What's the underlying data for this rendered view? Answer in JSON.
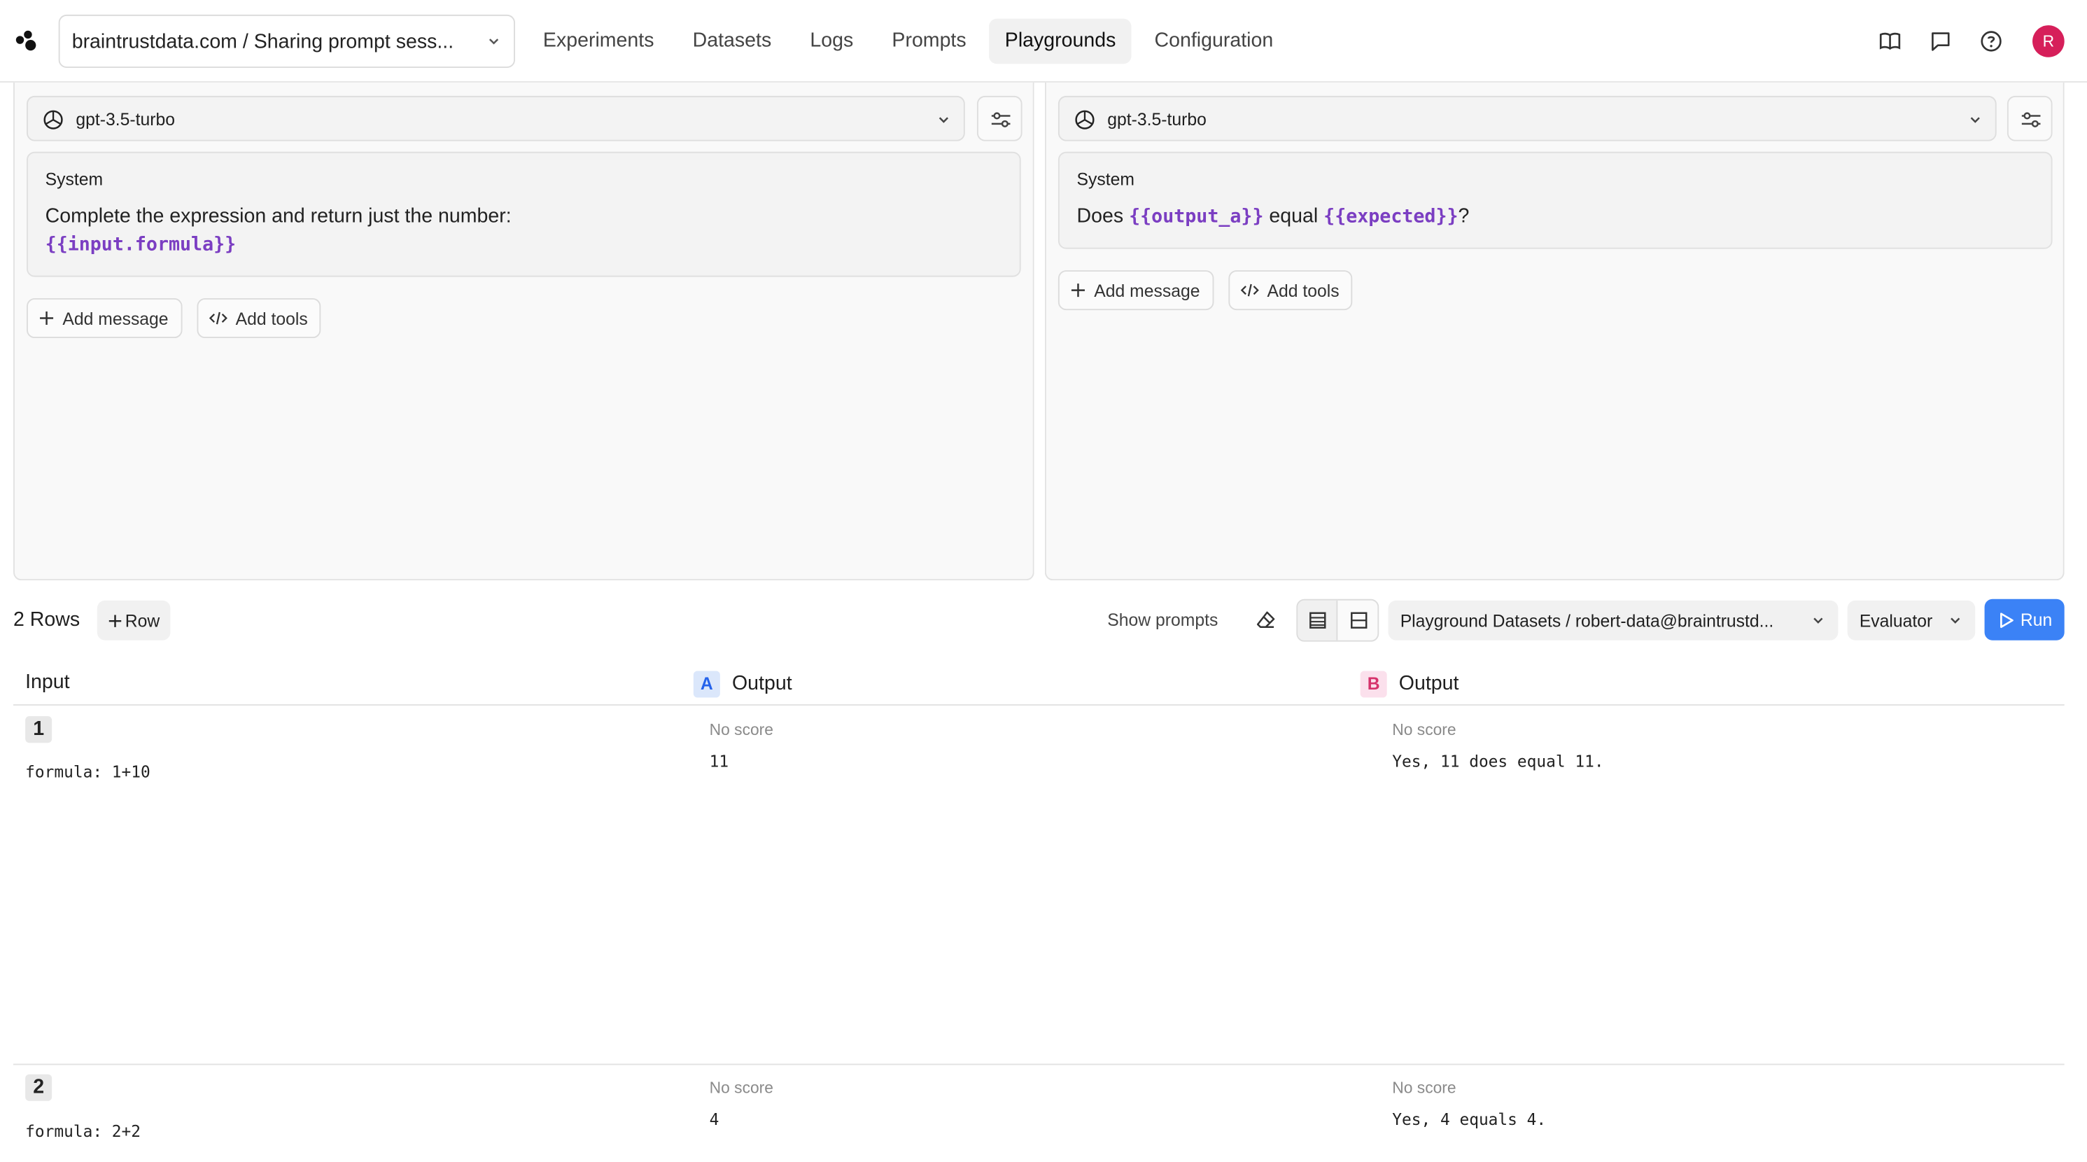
{
  "header": {
    "project": "braintrustdata.com / Sharing prompt sess...",
    "nav": [
      "Experiments",
      "Datasets",
      "Logs",
      "Prompts",
      "Playgrounds",
      "Configuration"
    ],
    "active_nav": "Playgrounds",
    "avatar_initial": "R",
    "icons": [
      "book-icon",
      "chat-icon",
      "help-icon"
    ]
  },
  "panel_a": {
    "model": "gpt-3.5-turbo",
    "system_label": "System",
    "prompt_text": "Complete the expression and return just the number:",
    "prompt_var": "{{input.formula}}",
    "add_message": "Add message",
    "add_tools": "Add tools"
  },
  "panel_b": {
    "model": "gpt-3.5-turbo",
    "system_label": "System",
    "prompt_prefix": "Does",
    "var_1": "{{output_a}}",
    "prompt_mid": "equal",
    "var_2": "{{expected}}",
    "prompt_suffix": "?",
    "add_message": "Add message",
    "add_tools": "Add tools"
  },
  "toolbar": {
    "rows_count": "2 Rows",
    "add_row": "Row",
    "show_prompts": "Show prompts",
    "dataset": "Playground Datasets / robert-data@braintrustd...",
    "evaluator": "Evaluator",
    "run": "Run"
  },
  "table": {
    "headers": {
      "input": "Input",
      "badge_a": "A",
      "output_a": "Output",
      "badge_b": "B",
      "output_b": "Output"
    },
    "rows": [
      {
        "num": "1",
        "input": "formula: 1+10",
        "score_a": "No score",
        "output_a": "11",
        "score_b": "No score",
        "output_b": "Yes, 11 does equal 11."
      },
      {
        "num": "2",
        "input": "formula: 2+2",
        "score_a": "No score",
        "output_a": "4",
        "score_b": "No score",
        "output_b": "Yes, 4 equals 4."
      }
    ]
  },
  "colors": {
    "accent": "#3b82f6",
    "template_var": "#7b3ec2",
    "avatar": "#d61f5a"
  }
}
